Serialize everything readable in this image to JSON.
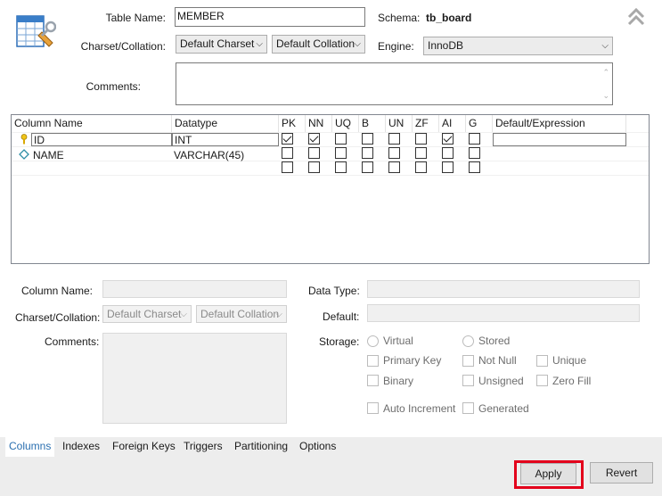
{
  "header": {
    "table_name_label": "Table Name:",
    "table_name_value": "MEMBER",
    "schema_label": "Schema:",
    "schema_value": "tb_board",
    "charset_label": "Charset/Collation:",
    "charset_value": "Default Charset",
    "collation_value": "Default Collation",
    "engine_label": "Engine:",
    "engine_value": "InnoDB",
    "comments_label": "Comments:"
  },
  "grid": {
    "headers": [
      "Column Name",
      "Datatype",
      "PK",
      "NN",
      "UQ",
      "B",
      "UN",
      "ZF",
      "AI",
      "G",
      "Default/Expression"
    ],
    "rows": [
      {
        "name": "ID",
        "type": "INT",
        "icon": "key-icon",
        "checks": [
          true,
          true,
          false,
          false,
          false,
          false,
          true,
          false
        ]
      },
      {
        "name": "NAME",
        "type": "VARCHAR(45)",
        "icon": "diamond-icon",
        "checks": [
          false,
          false,
          false,
          false,
          false,
          false,
          false,
          false
        ]
      },
      {
        "name": "",
        "type": "",
        "icon": "",
        "checks": [
          false,
          false,
          false,
          false,
          false,
          false,
          false,
          false
        ]
      }
    ]
  },
  "details": {
    "column_name_label": "Column Name:",
    "charset_label": "Charset/Collation:",
    "charset_value": "Default Charset",
    "collation_value": "Default Collation",
    "comments_label": "Comments:",
    "data_type_label": "Data Type:",
    "default_label": "Default:",
    "storage_label": "Storage:",
    "virtual_label": "Virtual",
    "stored_label": "Stored",
    "primary_key_label": "Primary Key",
    "not_null_label": "Not Null",
    "unique_label": "Unique",
    "binary_label": "Binary",
    "unsigned_label": "Unsigned",
    "zero_fill_label": "Zero Fill",
    "auto_increment_label": "Auto Increment",
    "generated_label": "Generated"
  },
  "tabs": [
    "Columns",
    "Indexes",
    "Foreign Keys",
    "Triggers",
    "Partitioning",
    "Options"
  ],
  "footer": {
    "apply_label": "Apply",
    "revert_label": "Revert"
  },
  "colors": {
    "active_tab": "#2a6fb0",
    "apply_highlight": "#e3001b"
  }
}
